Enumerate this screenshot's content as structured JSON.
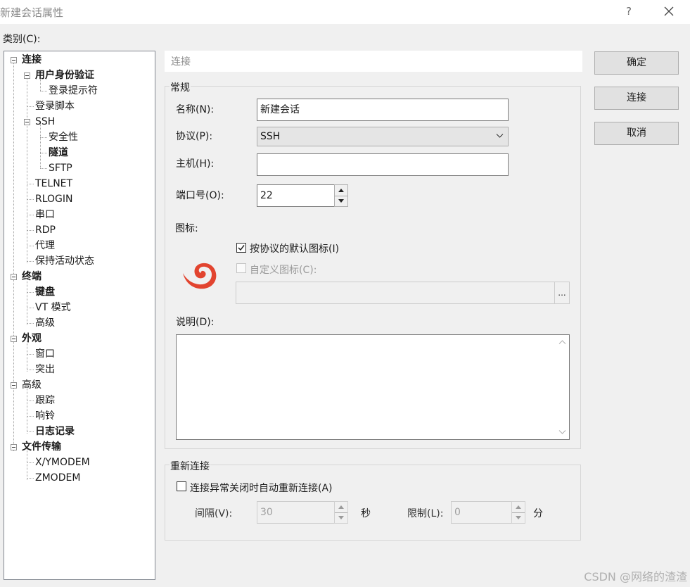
{
  "window": {
    "title": "新建会话属性",
    "help_glyph": "?"
  },
  "category_label": "类别(C):",
  "tree": [
    {
      "label": "连接",
      "bold": true,
      "expanded": true,
      "level": 0
    },
    {
      "label": "用户身份验证",
      "bold": true,
      "expanded": true,
      "level": 1
    },
    {
      "label": "登录提示符",
      "bold": false,
      "level": 2
    },
    {
      "label": "登录脚本",
      "bold": false,
      "level": 1
    },
    {
      "label": "SSH",
      "bold": false,
      "expanded": true,
      "level": 1
    },
    {
      "label": "安全性",
      "bold": false,
      "level": 2
    },
    {
      "label": "隧道",
      "bold": true,
      "level": 2
    },
    {
      "label": "SFTP",
      "bold": false,
      "level": 2
    },
    {
      "label": "TELNET",
      "bold": false,
      "level": 1
    },
    {
      "label": "RLOGIN",
      "bold": false,
      "level": 1
    },
    {
      "label": "串口",
      "bold": false,
      "level": 1
    },
    {
      "label": "RDP",
      "bold": false,
      "level": 1
    },
    {
      "label": "代理",
      "bold": false,
      "level": 1
    },
    {
      "label": "保持活动状态",
      "bold": false,
      "level": 1
    },
    {
      "label": "终端",
      "bold": true,
      "expanded": true,
      "level": 0
    },
    {
      "label": "键盘",
      "bold": true,
      "level": 1
    },
    {
      "label": "VT 模式",
      "bold": false,
      "level": 1
    },
    {
      "label": "高级",
      "bold": false,
      "level": 1
    },
    {
      "label": "外观",
      "bold": true,
      "expanded": true,
      "level": 0
    },
    {
      "label": "窗口",
      "bold": false,
      "level": 1
    },
    {
      "label": "突出",
      "bold": false,
      "level": 1
    },
    {
      "label": "高级",
      "bold": false,
      "expanded": true,
      "level": 0
    },
    {
      "label": "跟踪",
      "bold": false,
      "level": 1
    },
    {
      "label": "响铃",
      "bold": false,
      "level": 1
    },
    {
      "label": "日志记录",
      "bold": true,
      "level": 1
    },
    {
      "label": "文件传输",
      "bold": true,
      "expanded": true,
      "level": 0
    },
    {
      "label": "X/YMODEM",
      "bold": false,
      "level": 1
    },
    {
      "label": "ZMODEM",
      "bold": false,
      "level": 1
    }
  ],
  "section_header": "连接",
  "general": {
    "title": "常规",
    "name_label": "名称(N):",
    "name_value": "新建会话",
    "protocol_label": "协议(P):",
    "protocol_value": "SSH",
    "host_label": "主机(H):",
    "host_value": "",
    "port_label": "端口号(O):",
    "port_value": "22",
    "icon_label": "图标:",
    "default_icon_label": "按协议的默认图标(I)",
    "default_icon_checked": true,
    "custom_icon_label": "自定义图标(C):",
    "custom_icon_checked": false,
    "custom_icon_path": "",
    "browse_label": "...",
    "icon_name": "xshell-swirl-icon",
    "icon_color": "#e2442f",
    "description_label": "说明(D):",
    "description_value": ""
  },
  "reconnect": {
    "title": "重新连接",
    "auto_label": "连接异常关闭时自动重新连接(A)",
    "auto_checked": false,
    "interval_label": "间隔(V):",
    "interval_value": "30",
    "interval_unit": "秒",
    "limit_label": "限制(L):",
    "limit_value": "0",
    "limit_unit": "分"
  },
  "buttons": {
    "ok": "确定",
    "connect": "连接",
    "cancel": "取消"
  },
  "watermark": "CSDN @网络的渣渣"
}
